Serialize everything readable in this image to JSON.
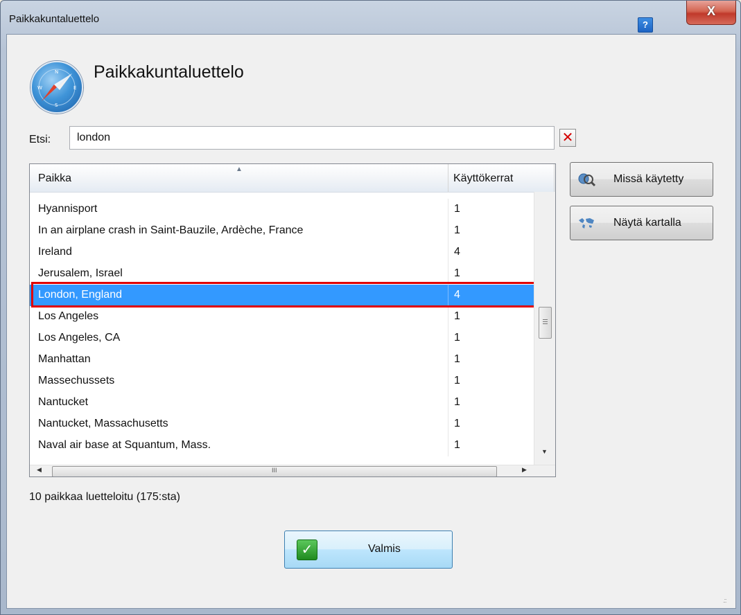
{
  "window": {
    "title": "Paikkakuntaluettelo",
    "help_label": "?",
    "close_label": "X"
  },
  "header": {
    "icon": "compass-icon",
    "title": "Paikkakuntaluettelo"
  },
  "search": {
    "label": "Etsi:",
    "value": "london",
    "clear_label": "✕"
  },
  "table": {
    "columns": [
      "Paikka",
      "Käyttökerrat"
    ],
    "rows": [
      {
        "place": "Hyannisport",
        "count": "1"
      },
      {
        "place": "In an airplane crash in Saint-Bauzile, Ardèche, France",
        "count": "1"
      },
      {
        "place": "Ireland",
        "count": "4"
      },
      {
        "place": "Jerusalem, Israel",
        "count": "1"
      },
      {
        "place": "London, England",
        "count": "4"
      },
      {
        "place": "Los Angeles",
        "count": "1"
      },
      {
        "place": "Los Angeles, CA",
        "count": "1"
      },
      {
        "place": "Manhattan",
        "count": "1"
      },
      {
        "place": "Massechussets",
        "count": "1"
      },
      {
        "place": "Nantucket",
        "count": "1"
      },
      {
        "place": "Nantucket, Massachusetts",
        "count": "1"
      },
      {
        "place": "Naval air base at Squantum, Mass.",
        "count": "1"
      }
    ],
    "selected_index": 4
  },
  "buttons": {
    "where_used": "Missä käytetty",
    "show_on_map": "Näytä kartalla",
    "done": "Valmis"
  },
  "status": "10 paikkaa luetteloitu (175:sta)",
  "colors": {
    "selection": "#3399ff",
    "highlight_border": "#e00000"
  }
}
